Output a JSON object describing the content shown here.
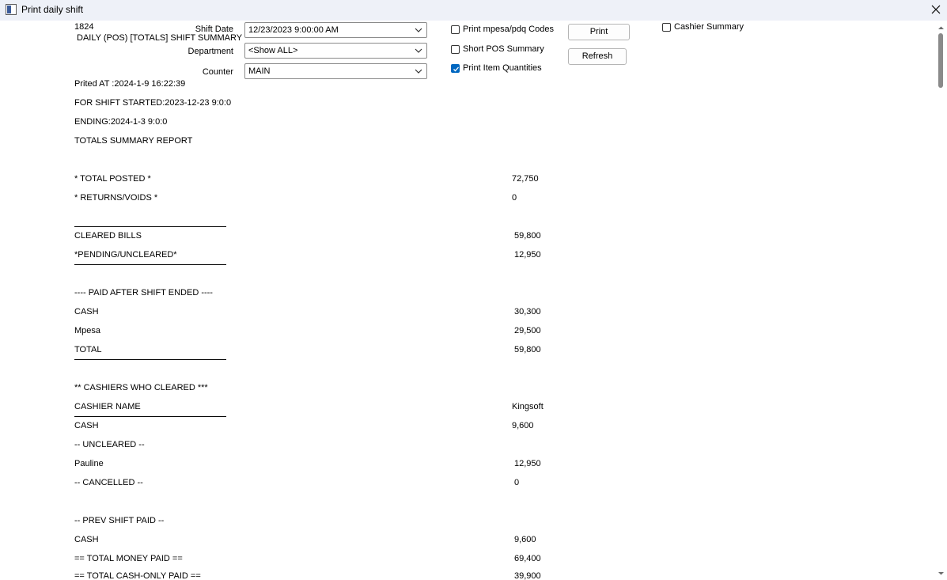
{
  "window": {
    "title": "Print daily shift"
  },
  "form": {
    "shift_date_label": "Shift Date",
    "shift_date_value": "12/23/2023 9:00:00 AM",
    "department_label": "Department",
    "department_value": "<Show ALL>",
    "counter_label": "Counter",
    "counter_value": "MAIN",
    "print_codes_label": "Print mpesa/pdq Codes",
    "print_codes_checked": false,
    "short_pos_label": "Short POS Summary",
    "short_pos_checked": false,
    "print_qty_label": "Print Item Quantities",
    "print_qty_checked": true,
    "print_button": "Print",
    "refresh_button": "Refresh",
    "cashier_summary_label": "Cashier Summary",
    "cashier_summary_checked": false
  },
  "report": {
    "id": "1824",
    "heading": "DAILY (POS) [TOTALS] SHIFT SUMMARY",
    "printed_at": "Prited AT :2024-1-9 16:22:39",
    "shift_started": "FOR SHIFT STARTED:2023-12-23 9:0:0",
    "ending": "ENDING:2024-1-3 9:0:0",
    "report_type": "TOTALS SUMMARY REPORT",
    "lines": [
      {
        "label": "* TOTAL POSTED *",
        "value": "72,750"
      },
      {
        "label": "* RETURNS/VOIDS *",
        "value": "0"
      },
      {
        "label": "CLEARED BILLS",
        "value": "59,800"
      },
      {
        "label": "*PENDING/UNCLEARED*",
        "value": "12,950"
      },
      {
        "label": "---- PAID AFTER SHIFT ENDED ----",
        "value": ""
      },
      {
        "label": "CASH",
        "value": "30,300"
      },
      {
        "label": "Mpesa",
        "value": "29,500"
      },
      {
        "label": "TOTAL",
        "value": "59,800"
      },
      {
        "label": " ** CASHIERS WHO CLEARED ***",
        "value": ""
      },
      {
        "label": "CASHIER NAME",
        "value": "Kingsoft"
      },
      {
        "label": "CASH",
        "value": "9,600"
      },
      {
        "label": "-- UNCLEARED --",
        "value": ""
      },
      {
        "label": "Pauline",
        "value": "12,950"
      },
      {
        "label": " -- CANCELLED --",
        "value": "0"
      },
      {
        "label": " -- PREV SHIFT PAID --",
        "value": ""
      },
      {
        "label": "CASH",
        "value": "9,600"
      },
      {
        "label": "== TOTAL MONEY PAID ==",
        "value": "69,400"
      },
      {
        "label": "== TOTAL CASH-ONLY PAID ==",
        "value": "39,900"
      }
    ]
  }
}
